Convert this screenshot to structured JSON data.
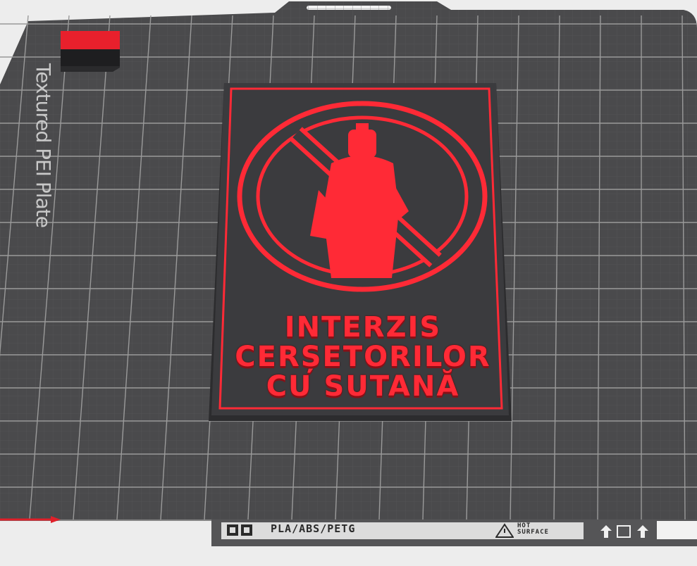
{
  "plate": {
    "name": "Textured PEI Plate",
    "strip_text": "PLA/ABS/PETG",
    "hot_surface": [
      "HOT",
      "SURFACE"
    ]
  },
  "model": {
    "text_lines": [
      "INTERZIS",
      "CERȘETORILOR",
      "CU SUTANĂ"
    ]
  },
  "colors": {
    "background": "#ededed",
    "plate": "#4a4a4c",
    "sign_base": "#3a3a3d",
    "accent_red": "#ff2a36",
    "grid": "#8f8f8f"
  },
  "icons": [
    "filament-profile-icon",
    "warning-triangle-icon",
    "arrow-up-icon",
    "square-icon"
  ]
}
